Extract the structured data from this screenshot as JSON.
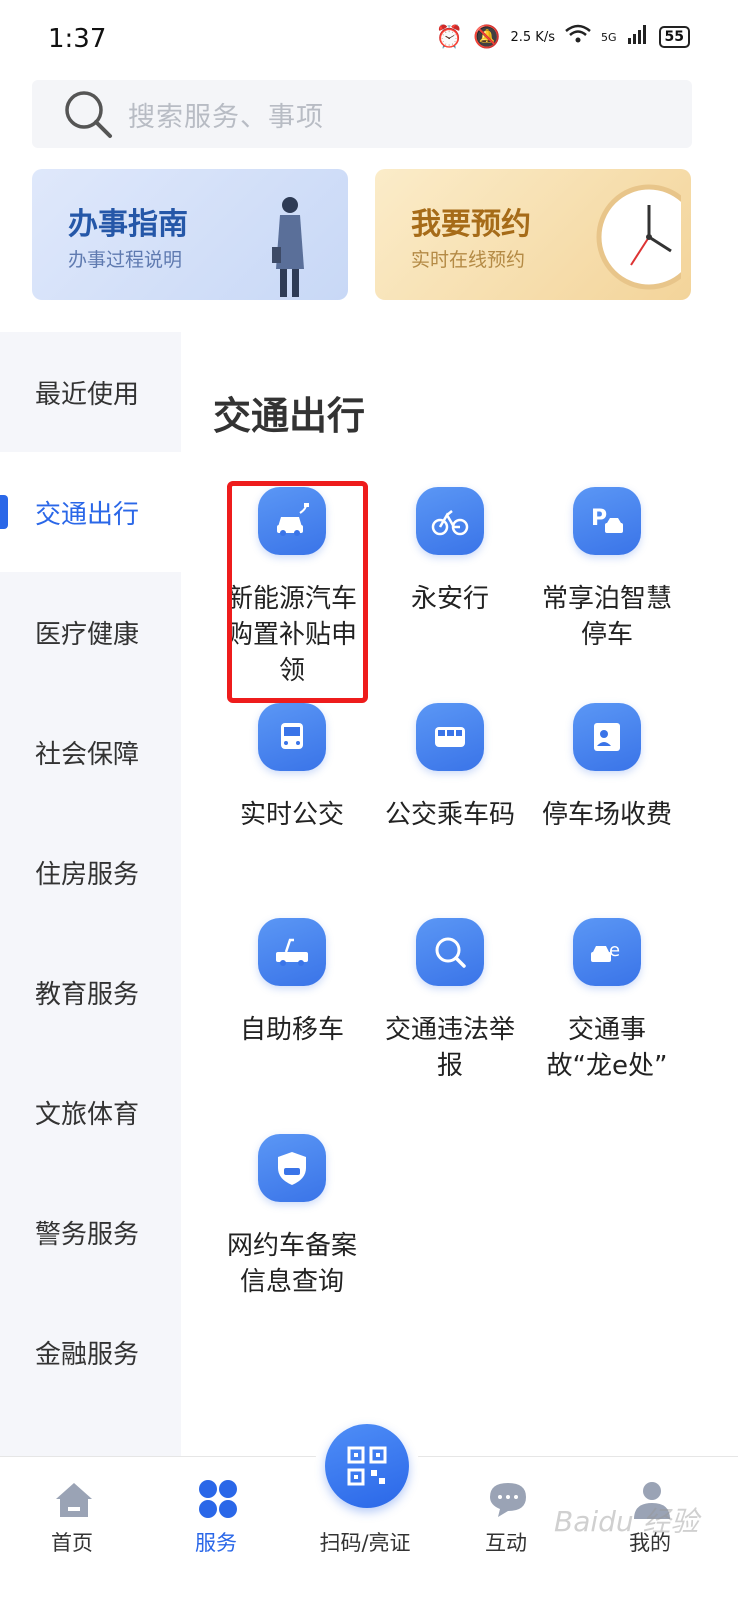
{
  "status_bar": {
    "time": "1:37",
    "net_speed": "2.5 K/s",
    "signal": "5G",
    "battery": "55"
  },
  "search": {
    "placeholder": "搜索服务、事项"
  },
  "banners": [
    {
      "title": "办事指南",
      "subtitle": "办事过程说明"
    },
    {
      "title": "我要预约",
      "subtitle": "实时在线预约"
    }
  ],
  "sidebar": {
    "items": [
      {
        "label": "最近使用"
      },
      {
        "label": "交通出行",
        "active": true
      },
      {
        "label": "医疗健康"
      },
      {
        "label": "社会保障"
      },
      {
        "label": "住房服务"
      },
      {
        "label": "教育服务"
      },
      {
        "label": "文旅体育"
      },
      {
        "label": "警务服务"
      },
      {
        "label": "金融服务"
      }
    ]
  },
  "section": {
    "title": "交通出行",
    "items": [
      {
        "label": "新能源汽车购置补贴申领",
        "icon": "ev-car-icon",
        "highlighted": true
      },
      {
        "label": "永安行",
        "icon": "bicycle-icon"
      },
      {
        "label": "常享泊智慧停车",
        "icon": "parking-icon"
      },
      {
        "label": "实时公交",
        "icon": "bus-icon"
      },
      {
        "label": "公交乘车码",
        "icon": "bus-ticket-icon"
      },
      {
        "label": "停车场收费",
        "icon": "parking-fee-icon"
      },
      {
        "label": "自助移车",
        "icon": "tow-truck-icon"
      },
      {
        "label": "交通违法举报",
        "icon": "violation-search-icon"
      },
      {
        "label": "交通事故“龙e处”",
        "icon": "accident-icon"
      },
      {
        "label": "网约车备案信息查询",
        "icon": "ride-hailing-icon"
      }
    ]
  },
  "bottom_nav": {
    "items": [
      {
        "label": "首页",
        "icon": "home-icon"
      },
      {
        "label": "服务",
        "icon": "services-icon",
        "active": true
      },
      {
        "label": "扫码/亮证",
        "icon": "qr-code-icon"
      },
      {
        "label": "互动",
        "icon": "chat-icon"
      },
      {
        "label": "我的",
        "icon": "profile-icon"
      }
    ]
  },
  "watermark": "Baidu 经验",
  "colors": {
    "accent": "#2a67e8",
    "highlight": "#ee1c1c",
    "sidebar_bg": "#f5f6fa"
  }
}
